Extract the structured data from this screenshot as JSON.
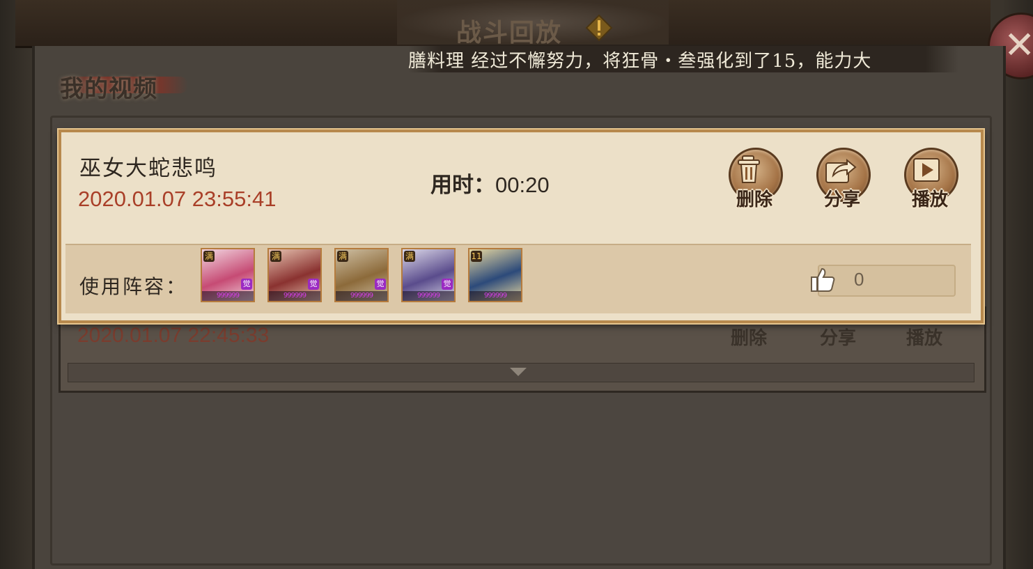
{
  "header": {
    "title": "战斗回放",
    "warning_icon": "exclamation-diamond-icon"
  },
  "ticker": {
    "text": "膳料理 经过不懈努力，将狂骨・叁强化到了15，能力大"
  },
  "tab": {
    "label": "我的视频"
  },
  "videos": [
    {
      "name": "巫女大蛇悲鸣",
      "datetime": "2020.01.07 23:55:41",
      "duration_label": "用时：",
      "duration": "00:20",
      "actions": {
        "delete": "删除",
        "share": "分享",
        "play": "播放"
      },
      "lineup_label": "使用阵容：",
      "lineup": [
        {
          "badge": "满",
          "tag": "觉",
          "stars": "999999",
          "colors": [
            "#c64b74",
            "#f2d6e0"
          ]
        },
        {
          "badge": "满",
          "tag": "觉",
          "stars": "999999",
          "colors": [
            "#8a3230",
            "#e6c2b0"
          ]
        },
        {
          "badge": "满",
          "tag": "觉",
          "stars": "999999",
          "colors": [
            "#8c6a3a",
            "#cfc0a4"
          ]
        },
        {
          "badge": "满",
          "tag": "觉",
          "stars": "999999",
          "colors": [
            "#5a4c8c",
            "#dcd8e8"
          ]
        },
        {
          "badge": "11",
          "tag": "",
          "stars": "999999",
          "colors": [
            "#2c4a7a",
            "#e8d8a0"
          ]
        }
      ],
      "likes": "0"
    },
    {
      "datetime": "2020.01.07 22:45:33",
      "actions": {
        "delete": "删除",
        "share": "分享",
        "play": "播放"
      }
    }
  ],
  "colors": {
    "accent_date": "#a93f28",
    "card_bg": "#ece0c8",
    "card_border": "#b7894d"
  }
}
